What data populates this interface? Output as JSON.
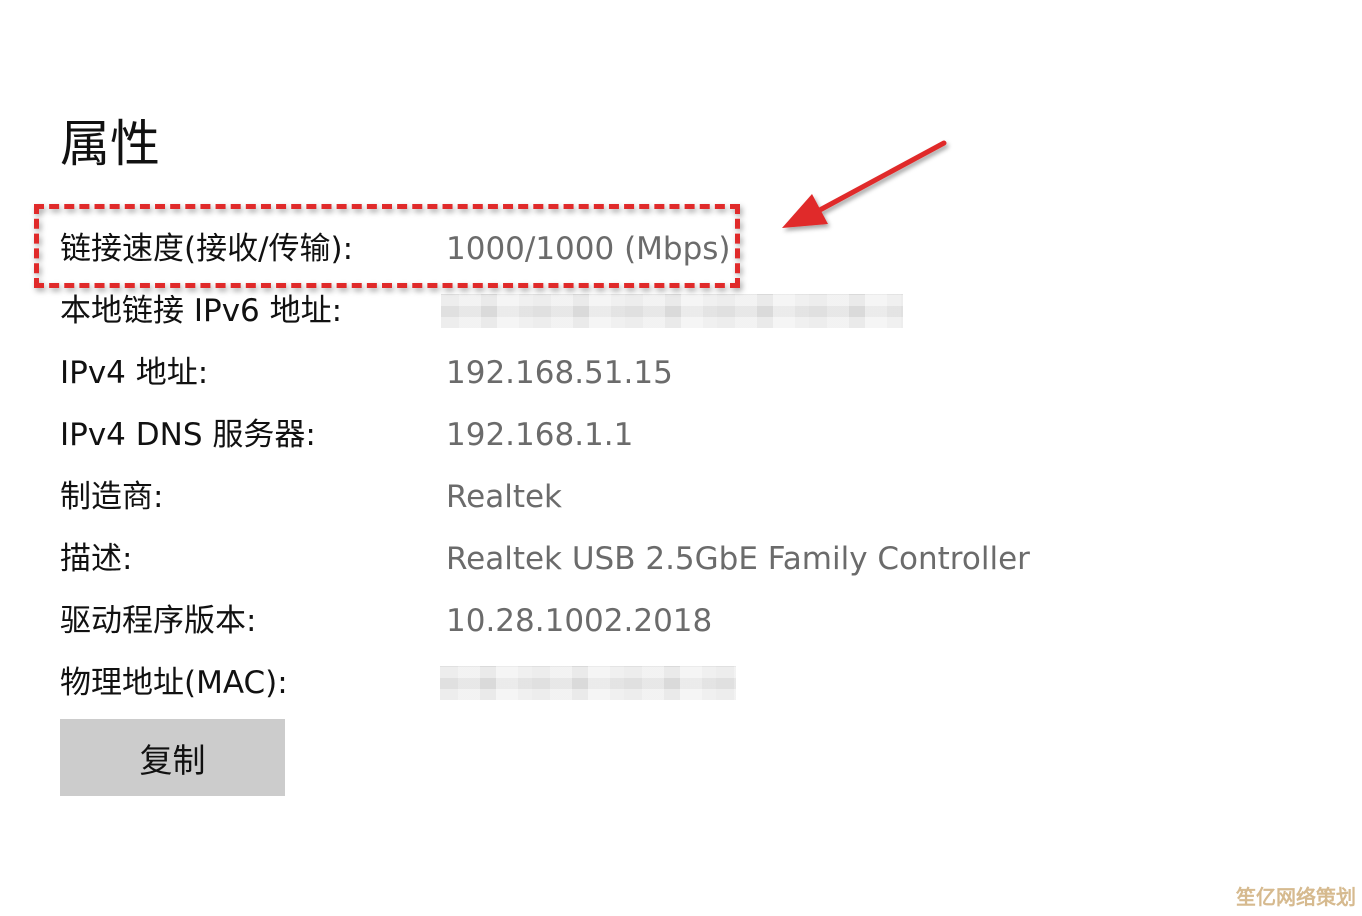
{
  "page": {
    "title": "属性"
  },
  "properties": [
    {
      "label": "链接速度(接收/传输):",
      "value": "1000/1000 (Mbps)"
    },
    {
      "label": "本地链接 IPv6 地址:",
      "value": ""
    },
    {
      "label": "IPv4 地址:",
      "value": "192.168.51.15"
    },
    {
      "label": "IPv4 DNS 服务器:",
      "value": "192.168.1.1"
    },
    {
      "label": "制造商:",
      "value": "Realtek"
    },
    {
      "label": "描述:",
      "value": "Realtek USB 2.5GbE Family Controller"
    },
    {
      "label": "驱动程序版本:",
      "value": "10.28.1002.2018"
    },
    {
      "label": "物理地址(MAC):",
      "value": ""
    }
  ],
  "actions": {
    "copy_label": "复制"
  },
  "annotation": {
    "color": "#e02a2a",
    "highlighted_row": "链接速度(接收/传输):"
  },
  "watermark": {
    "text": "笙亿网络策划"
  }
}
